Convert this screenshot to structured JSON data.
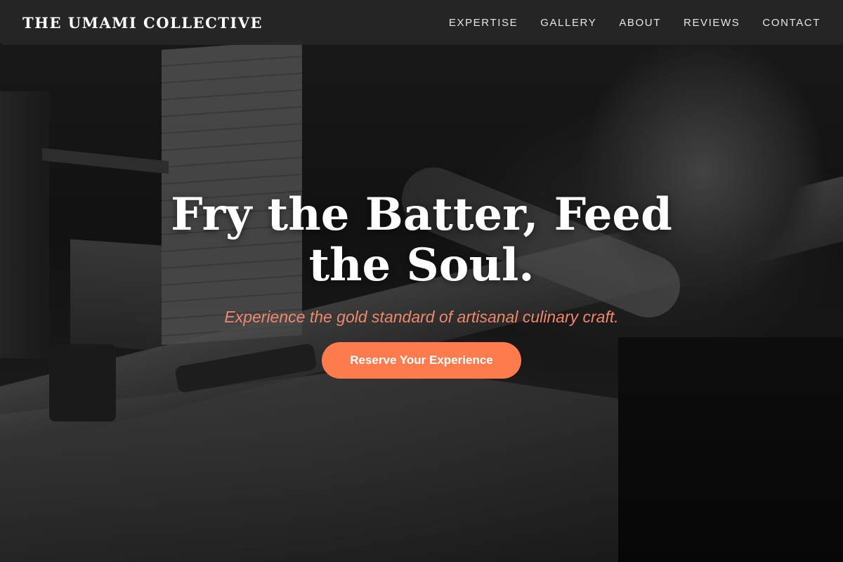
{
  "brand": {
    "name": "THE UMAMI COLLECTIVE"
  },
  "nav": {
    "items": [
      {
        "label": "EXPERTISE"
      },
      {
        "label": "GALLERY"
      },
      {
        "label": "ABOUT"
      },
      {
        "label": "REVIEWS"
      },
      {
        "label": "CONTACT"
      }
    ]
  },
  "hero": {
    "title": "Fry the Batter, Feed the Soul.",
    "subtitle": "Experience the gold standard of artisanal culinary craft.",
    "cta_label": "Reserve Your Experience",
    "image_description": "black-and-white photo of a person working wood on a workbench"
  },
  "colors": {
    "accent": "#fd7b4c",
    "subtitle": "#f0886a",
    "nav_background": "#262626"
  }
}
